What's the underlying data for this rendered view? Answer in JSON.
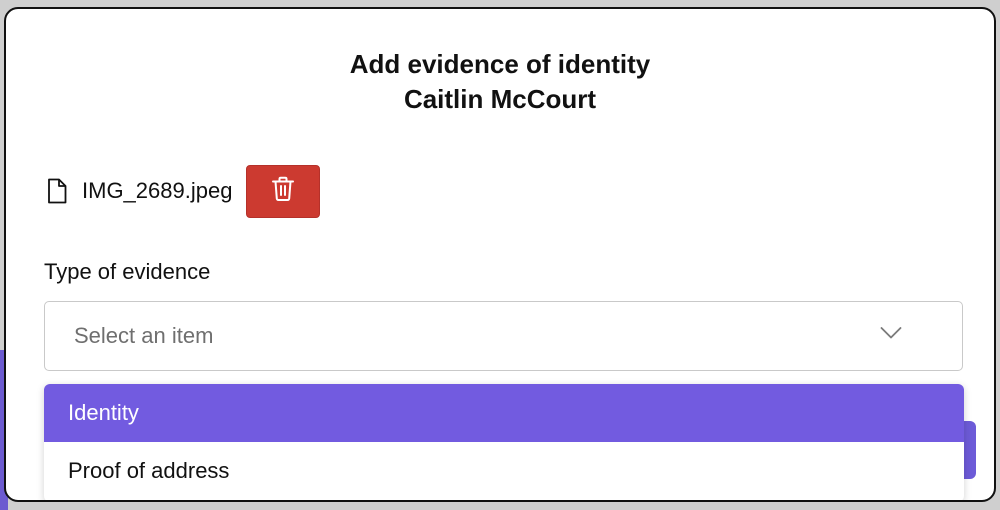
{
  "modal": {
    "title_line1": "Add evidence of identity",
    "title_line2": "Caitlin McCourt"
  },
  "file": {
    "name": "IMG_2689.jpeg",
    "icon": "file-icon",
    "delete_icon": "trash-icon",
    "delete_color": "#cc3a30"
  },
  "evidence_type": {
    "label": "Type of evidence",
    "placeholder": "Select an item",
    "options": [
      {
        "label": "Identity",
        "highlighted": true
      },
      {
        "label": "Proof of address",
        "highlighted": false
      }
    ],
    "highlight_color": "#725be0"
  }
}
